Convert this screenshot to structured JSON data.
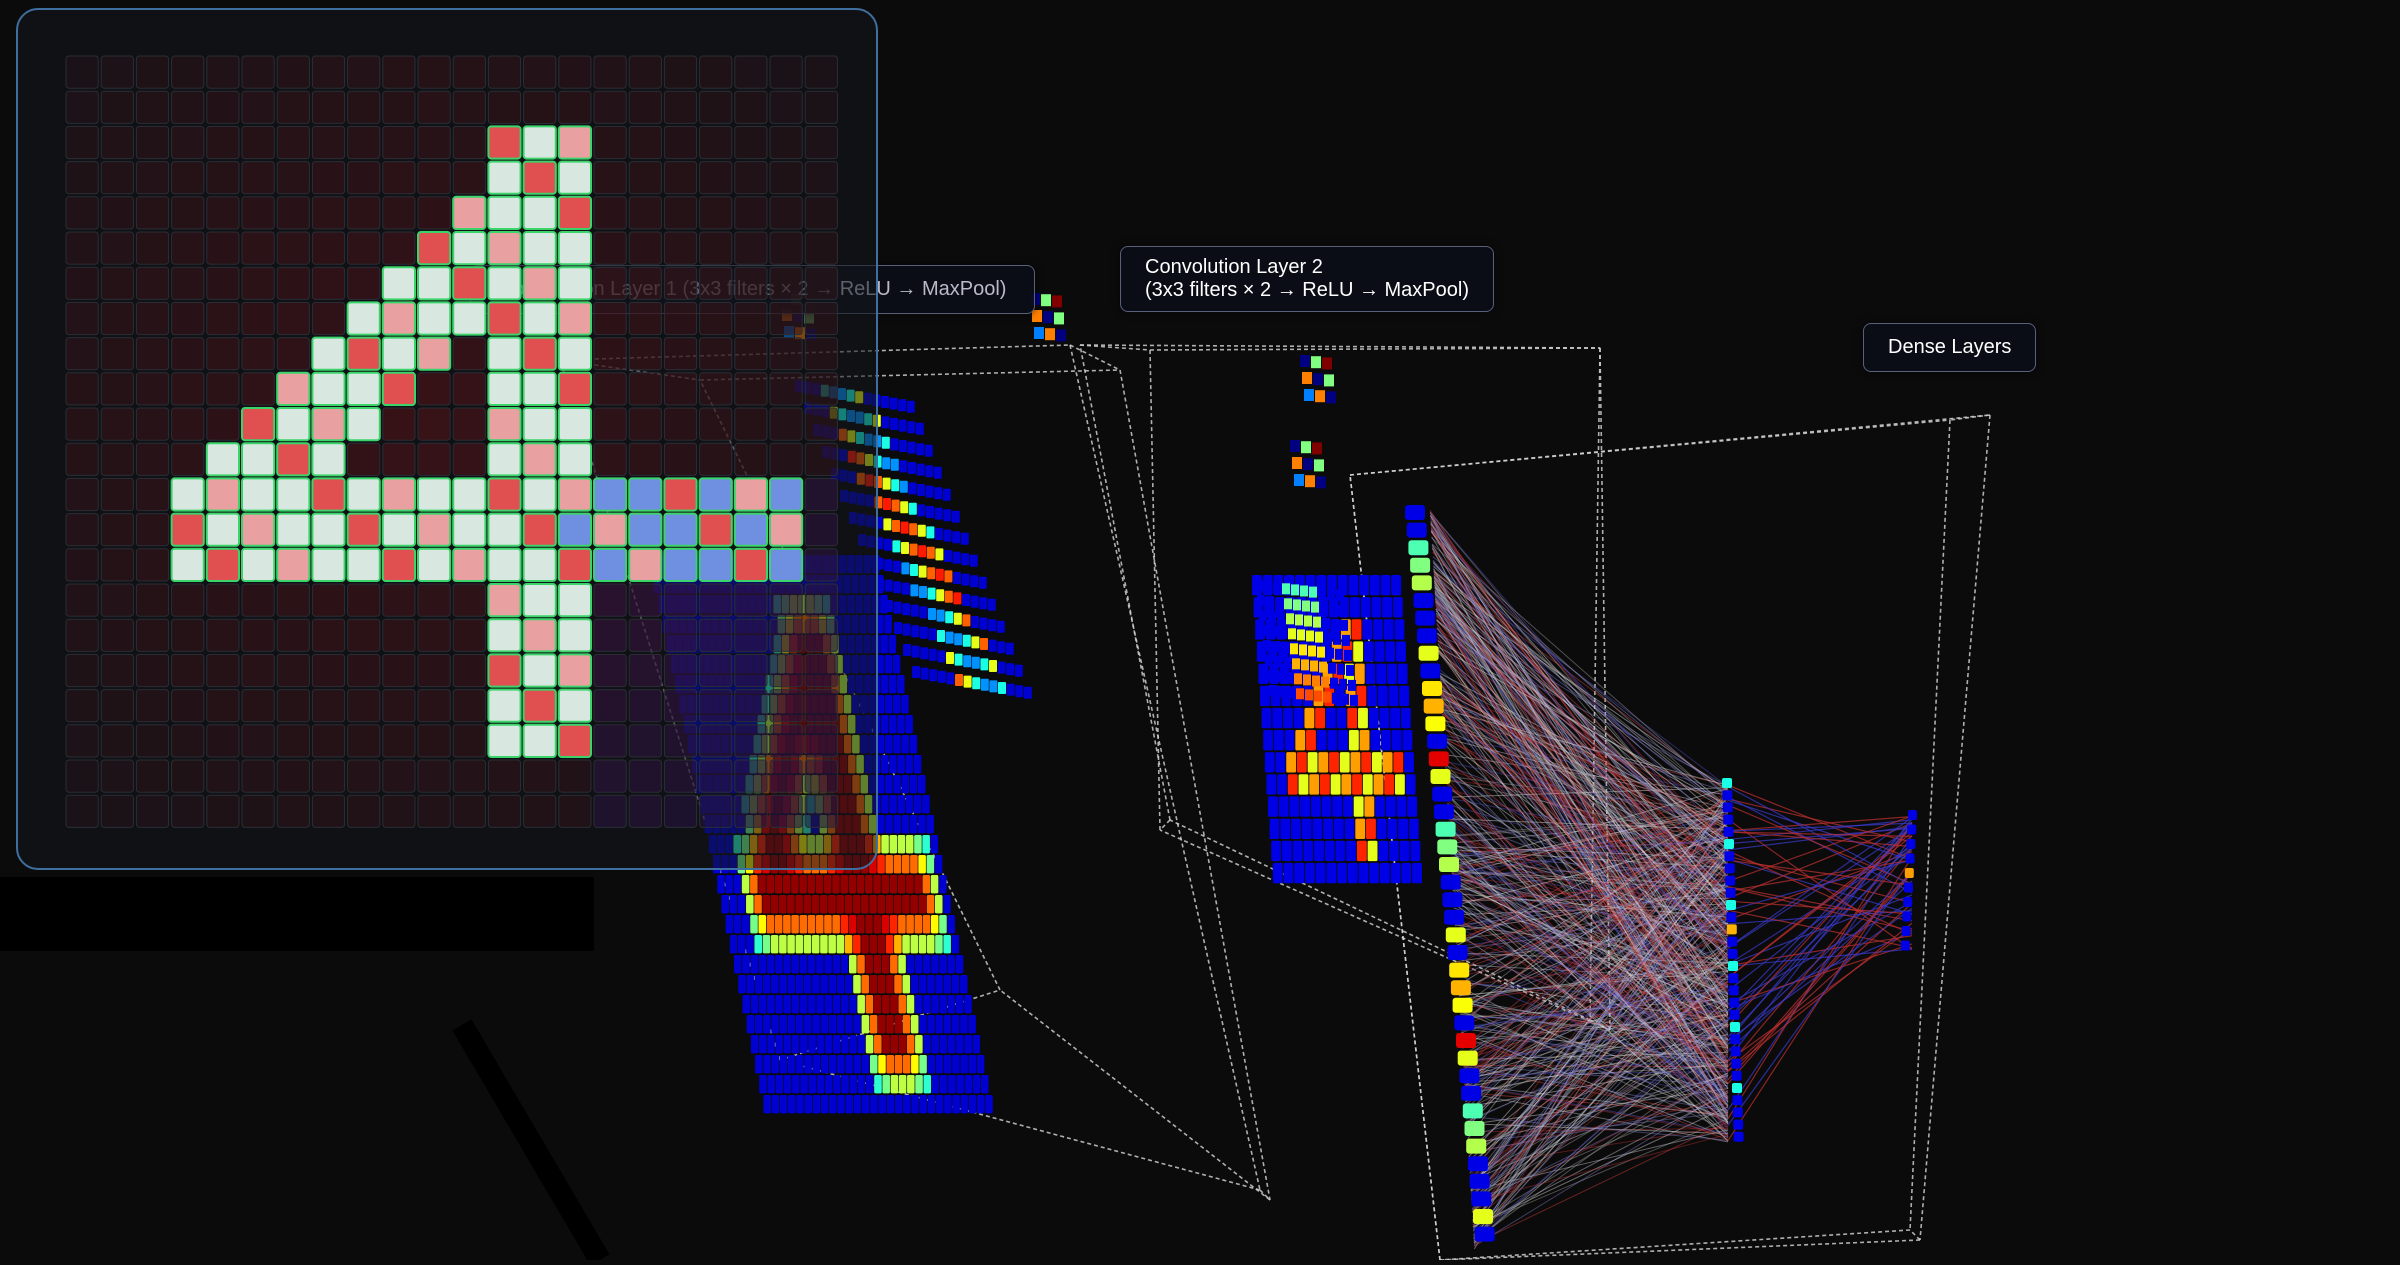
{
  "labels": {
    "conv1": "Convolution Layer 1 (3x3 filters × 2 → ReLU → MaxPool)",
    "conv2_line1": "Convolution Layer 2",
    "conv2_line2": "(3x3 filters × 2 → ReLU → MaxPool)",
    "dense": "Dense Layers"
  },
  "input": {
    "digit": "4",
    "grid_size": 22,
    "highlight_color": "#3bd46a"
  },
  "icons": {
    "layer_box": "wireframe-box"
  }
}
